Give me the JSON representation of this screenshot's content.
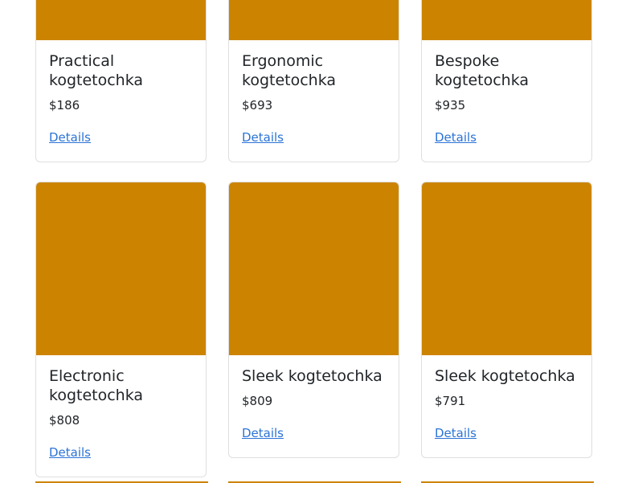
{
  "colors": {
    "image_placeholder": "#cc8400",
    "link": "#2b73d6",
    "card_border": "#dfdfdf"
  },
  "cards": [
    {
      "title": "Practical kogtetochka",
      "price": "$186",
      "link": "Details"
    },
    {
      "title": "Ergonomic kogtetochka",
      "price": "$693",
      "link": "Details"
    },
    {
      "title": "Bespoke kogtetochka",
      "price": "$935",
      "link": "Details"
    },
    {
      "title": "Electronic kogtetochka",
      "price": "$808",
      "link": "Details"
    },
    {
      "title": "Sleek kogtetochka",
      "price": "$809",
      "link": "Details"
    },
    {
      "title": "Sleek kogtetochka",
      "price": "$791",
      "link": "Details"
    }
  ]
}
